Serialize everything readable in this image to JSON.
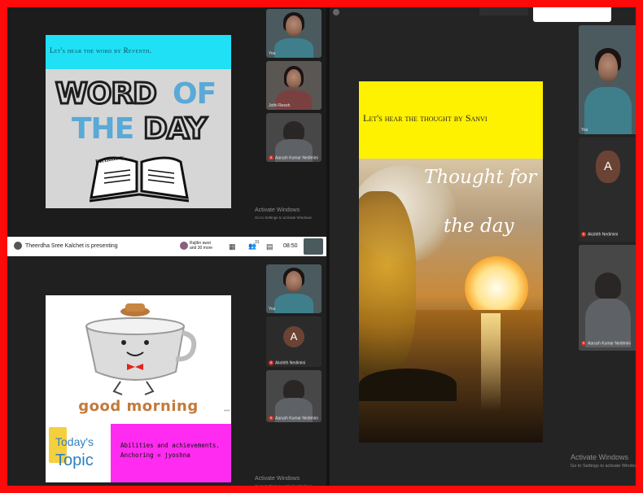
{
  "slides": {
    "word": {
      "caption": "Let's hear the word by Reventh.",
      "title_word": "WORD",
      "title_of": "OF",
      "title_the": "THE",
      "title_day": "DAY",
      "book_label": "Dictionary"
    },
    "thought": {
      "caption": "Let's hear the thought by Sanvi",
      "line1": "Thought for",
      "line2": "the day"
    },
    "morning": {
      "greeting": "good morning",
      "todays": "Today's",
      "topic": "Topic",
      "topic_line1": "Abilities and achievements.",
      "topic_line2": "Anchoring = jyoshna"
    }
  },
  "toolbar": {
    "presenting": "Theerdha Sree Kalchet is presenting",
    "people_text": "Rajlbn awst and 30 more",
    "participant_count": "31",
    "clock": "08:50"
  },
  "participants": {
    "top_col": [
      "You",
      "Jothi Reesh",
      "Aarush Kumar Nedimini"
    ],
    "bottom_col": [
      "You",
      "Akshith Nedimini",
      "Aarush Kumar Nedimini"
    ],
    "right_col": [
      "You",
      "Akshith Nedimini",
      "Aarush Kumar Nedimini"
    ],
    "avatar_letter": "A"
  },
  "watermark": {
    "title": "Activate Windows",
    "subtitle": "Go to Settings to activate Windows."
  },
  "colors": {
    "border": "#ff0a0a",
    "cyan_caption": "#1fe0f5",
    "yellow_caption": "#fff200",
    "magenta_topic": "#ff2bf0",
    "word_blue": "#5aa9d6"
  }
}
